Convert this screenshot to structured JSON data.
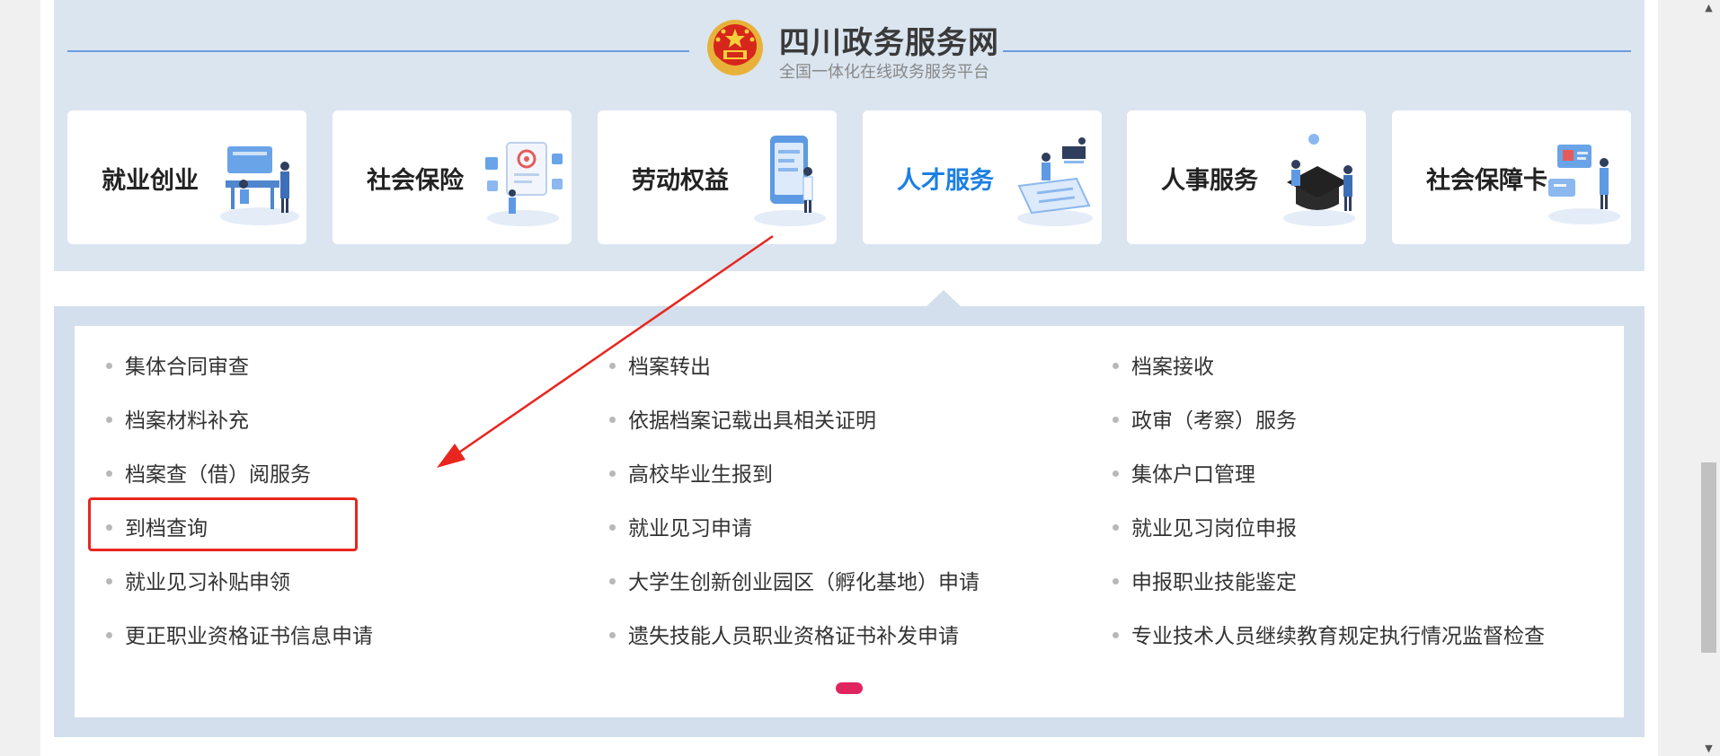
{
  "header": {
    "site_title": "四川政务服务网",
    "site_subtitle": "全国一体化在线政务服务平台"
  },
  "categories": [
    {
      "label": "就业创业",
      "icon": "employment-illustration-icon",
      "active": false
    },
    {
      "label": "社会保险",
      "icon": "social-insurance-illustration-icon",
      "active": false
    },
    {
      "label": "劳动权益",
      "icon": "labor-rights-illustration-icon",
      "active": false
    },
    {
      "label": "人才服务",
      "icon": "talent-service-illustration-icon",
      "active": true
    },
    {
      "label": "人事服务",
      "icon": "personnel-service-illustration-icon",
      "active": false
    },
    {
      "label": "社会保障卡",
      "icon": "social-security-card-illustration-icon",
      "active": false
    }
  ],
  "services": {
    "column1": [
      "集体合同审查",
      "档案材料补充",
      "档案查（借）阅服务",
      "到档查询",
      "就业见习补贴申领",
      "更正职业资格证书信息申请"
    ],
    "column2": [
      "档案转出",
      "依据档案记载出具相关证明",
      "高校毕业生报到",
      "就业见习申请",
      "大学生创新创业园区（孵化基地）申请",
      "遗失技能人员职业资格证书补发申请"
    ],
    "column3": [
      "档案接收",
      "政审（考察）服务",
      "集体户口管理",
      "就业见习岗位申报",
      "申报职业技能鉴定",
      "专业技术人员继续教育规定执行情况监督检查"
    ]
  },
  "annotation": {
    "highlighted_item": "到档查询",
    "color": "#e8261f"
  },
  "colors": {
    "accent": "#1b7fe3",
    "pager_active": "#e0245e",
    "band": "#dbe5f0"
  },
  "scrollbar": {
    "up_glyph": "▲",
    "down_glyph": "▼"
  }
}
